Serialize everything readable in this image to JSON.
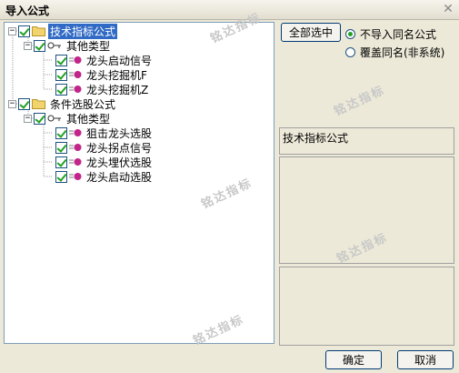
{
  "window": {
    "title": "导入公式",
    "close_glyph": "✕"
  },
  "tree": {
    "groups": [
      {
        "label": "技术指标公式",
        "subgroup": "其他类型",
        "items": [
          "龙头启动信号",
          "龙头挖掘机F",
          "龙头挖掘机Z"
        ]
      },
      {
        "label": "条件选股公式",
        "subgroup": "其他类型",
        "items": [
          "狙击龙头选股",
          "龙头拐点信号",
          "龙头埋伏选股",
          "龙头启动选股"
        ]
      }
    ]
  },
  "controls": {
    "select_all": "全部选中",
    "radio_skip": "不导入同名公式",
    "radio_overwrite": "覆盖同名(非系统)"
  },
  "info": {
    "type_label": "技术指标公式"
  },
  "footer": {
    "ok": "确定",
    "cancel": "取消"
  },
  "watermark": "铭达指标",
  "colors": {
    "selection": "#316ac5",
    "check": "#21a121",
    "folder": "#f2d46e",
    "formula": "#c2248a"
  }
}
